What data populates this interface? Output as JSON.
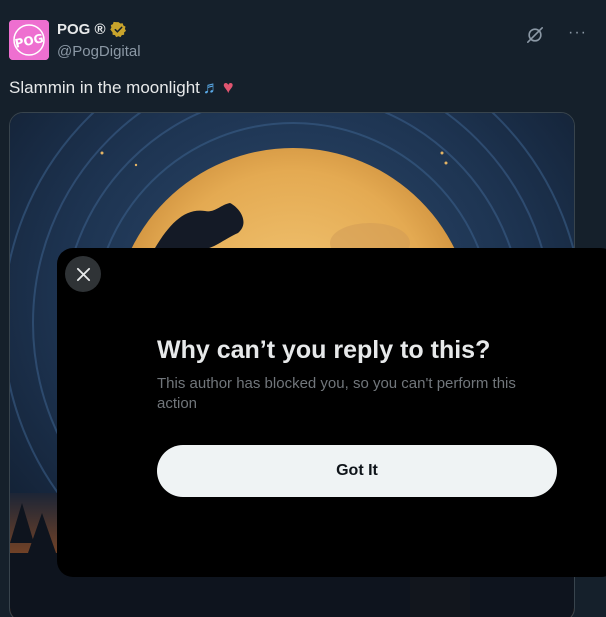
{
  "author": {
    "display_name": "POG ®",
    "handle": "@PogDigital",
    "avatar_text": "POG",
    "verified_icon": "gold-verified-icon",
    "avatar_color": "#ee6fd0"
  },
  "tweet": {
    "text": "Slammin in the moonlight",
    "emoji_notes": "♬",
    "emoji_heart": "♥"
  },
  "actions": {
    "grok_icon": "grok-icon",
    "more_label": "···"
  },
  "modal": {
    "title": "Why can’t you reply to this?",
    "body": "This author has blocked you, so you can't perform this action",
    "button_label": "Got It",
    "close_icon": "close-icon"
  },
  "colors": {
    "background": "#15202b",
    "modal_bg": "#000000",
    "button_bg": "#eff3f4",
    "secondary_text": "#71767b",
    "verified": "#c9a42c"
  }
}
